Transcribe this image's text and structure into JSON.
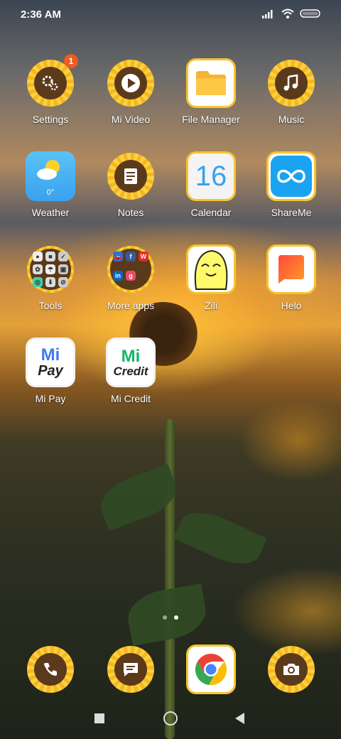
{
  "status_bar": {
    "time": "2:36 AM"
  },
  "apps": {
    "settings": {
      "label": "Settings",
      "badge": "1"
    },
    "mi_video": {
      "label": "Mi Video"
    },
    "file_manager": {
      "label": "File Manager"
    },
    "music": {
      "label": "Music"
    },
    "weather": {
      "label": "Weather",
      "temp": "0°"
    },
    "notes": {
      "label": "Notes"
    },
    "calendar": {
      "label": "Calendar",
      "day": "16"
    },
    "shareme": {
      "label": "ShareMe"
    },
    "tools": {
      "label": "Tools"
    },
    "more_apps": {
      "label": "More apps"
    },
    "zili": {
      "label": "Zili"
    },
    "helo": {
      "label": "Helo"
    },
    "mi_pay": {
      "label": "Mi Pay",
      "logo_top": "Mi",
      "logo_bottom": "Pay"
    },
    "mi_credit": {
      "label": "Mi Credit",
      "logo_top": "Mi",
      "logo_bottom": "Credit"
    }
  },
  "page_indicator": {
    "count": 2,
    "active": 2
  },
  "colors": {
    "accent": "#f4b516",
    "badge": "#f05a24",
    "disc": "#5b3a1b"
  }
}
